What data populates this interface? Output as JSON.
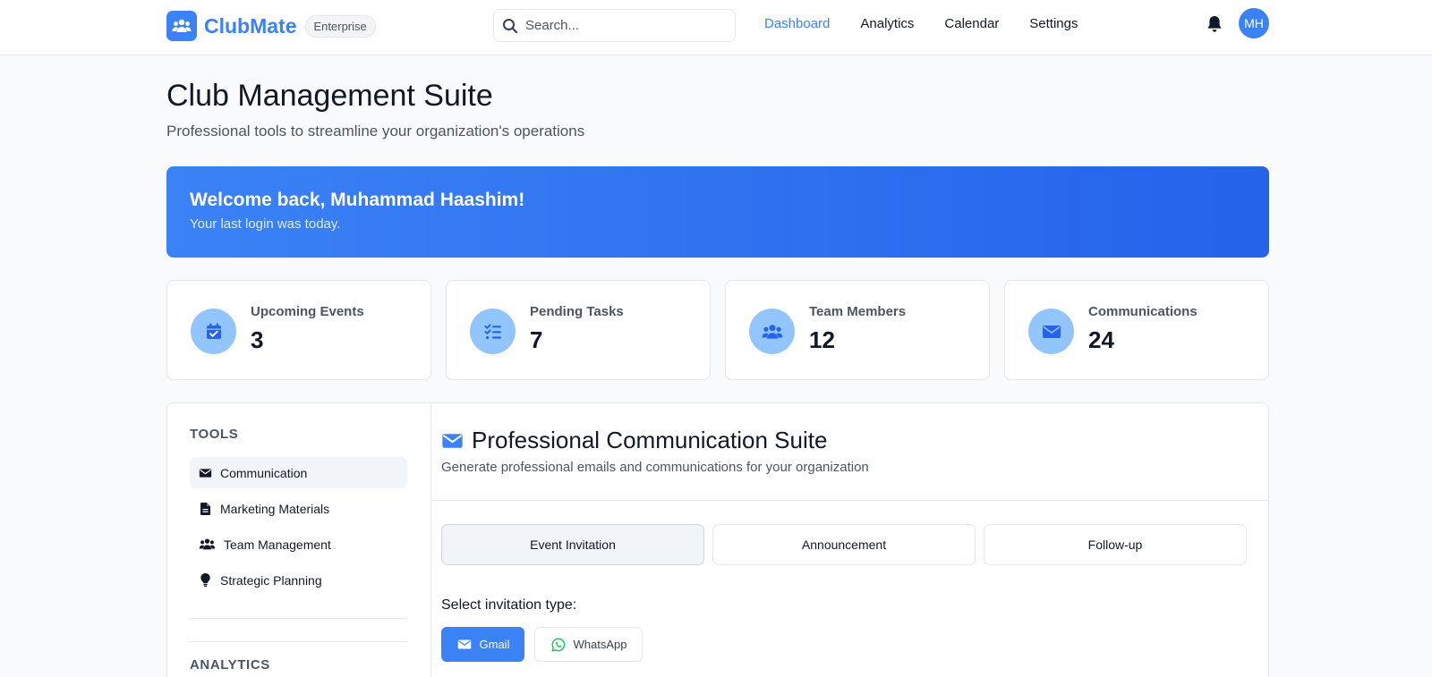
{
  "brand": {
    "name": "ClubMate",
    "badge": "Enterprise",
    "icon": "users-icon"
  },
  "search": {
    "placeholder": "Search..."
  },
  "nav": {
    "items": [
      "Dashboard",
      "Analytics",
      "Calendar",
      "Settings"
    ],
    "active": "Dashboard"
  },
  "user": {
    "initials": "MH"
  },
  "header": {
    "title": "Club Management Suite",
    "subtitle": "Professional tools to streamline your organization's operations"
  },
  "welcome": {
    "title": "Welcome back, Muhammad Haashim!",
    "subtitle": "Your last login was today."
  },
  "stats": [
    {
      "label": "Upcoming Events",
      "value": "3",
      "icon": "calendar-check-icon"
    },
    {
      "label": "Pending Tasks",
      "value": "7",
      "icon": "tasks-icon"
    },
    {
      "label": "Team Members",
      "value": "12",
      "icon": "users-icon"
    },
    {
      "label": "Communications",
      "value": "24",
      "icon": "envelope-icon"
    }
  ],
  "sidebar": {
    "tools_heading": "TOOLS",
    "items": [
      {
        "label": "Communication",
        "icon": "envelope-icon",
        "active": true
      },
      {
        "label": "Marketing Materials",
        "icon": "file-icon"
      },
      {
        "label": "Team Management",
        "icon": "users-icon"
      },
      {
        "label": "Strategic Planning",
        "icon": "lightbulb-icon"
      }
    ],
    "analytics_heading": "ANALYTICS"
  },
  "content": {
    "title": "Professional Communication Suite",
    "subtitle": "Generate professional emails and communications for your organization",
    "tabs": [
      "Event Invitation",
      "Announcement",
      "Follow-up"
    ],
    "active_tab": "Event Invitation",
    "select_label": "Select invitation type:",
    "channels": [
      {
        "label": "Gmail",
        "icon": "envelope-icon",
        "selected": true
      },
      {
        "label": "WhatsApp",
        "icon": "whatsapp-icon",
        "selected": false
      }
    ]
  },
  "colors": {
    "accent": "#3b82f6",
    "accent_dark": "#2563eb",
    "icon_bg": "#93c5fd",
    "whatsapp": "#22c55e"
  }
}
